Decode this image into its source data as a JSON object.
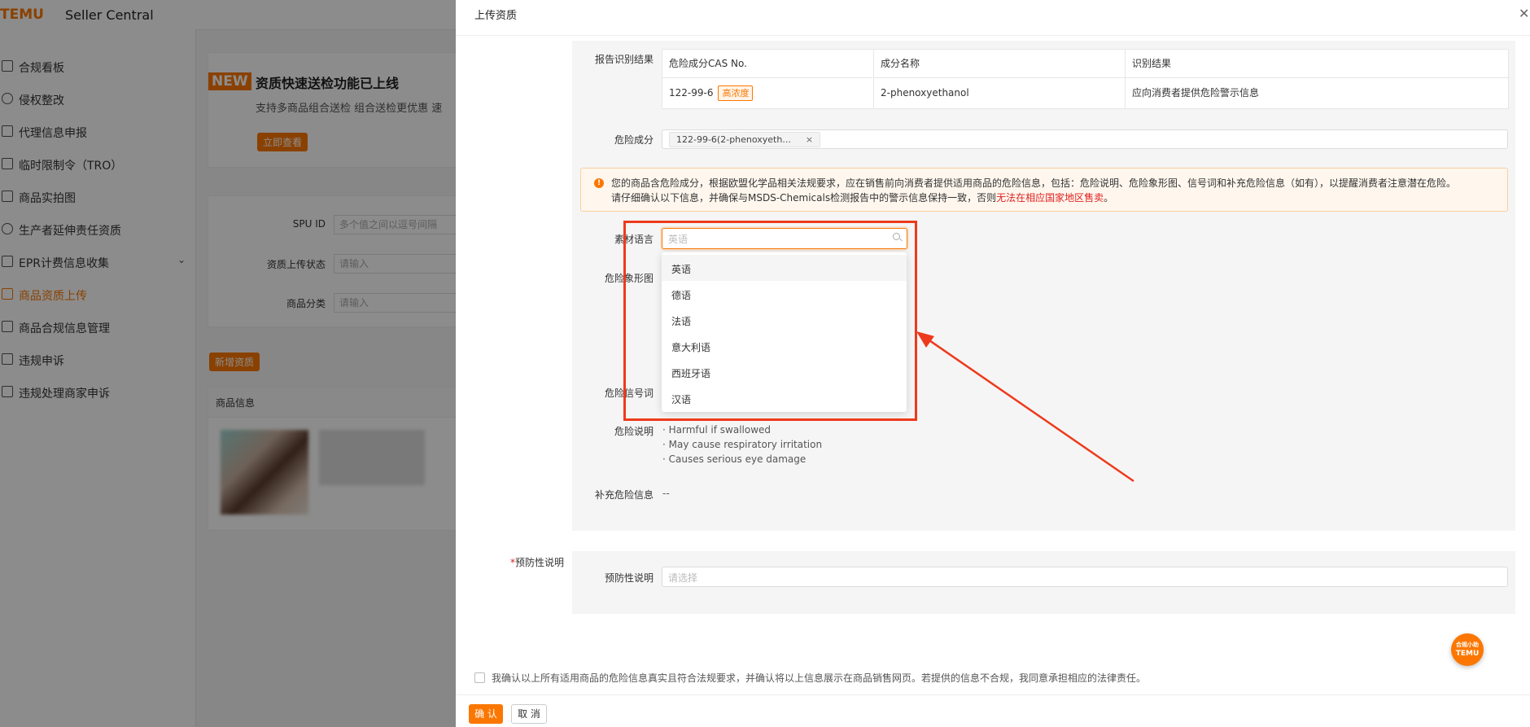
{
  "app": {
    "logo": "TEMU",
    "name": "Seller Central"
  },
  "sidebar": {
    "items": [
      {
        "label": "合规看板",
        "active": false
      },
      {
        "label": "侵权整改",
        "active": false
      },
      {
        "label": "代理信息申报",
        "active": false
      },
      {
        "label": "临时限制令（TRO）",
        "active": false
      },
      {
        "label": "商品实拍图",
        "active": false
      },
      {
        "label": "生产者延伸责任资质",
        "active": false
      },
      {
        "label": "EPR计费信息收集",
        "active": false
      },
      {
        "label": "商品资质上传",
        "active": true
      },
      {
        "label": "商品合规信息管理",
        "active": false
      },
      {
        "label": "违规申诉",
        "active": false
      },
      {
        "label": "违规处理商家申诉",
        "active": false
      }
    ]
  },
  "background": {
    "promo": {
      "badge": "NEW",
      "title": "资质快速送检功能已上线",
      "subtitle": "支持多商品组合送检 组合送检更优惠 速",
      "button": "立即查看"
    },
    "filters": [
      {
        "label": "SPU ID",
        "placeholder": "多个值之间以逗号间隔"
      },
      {
        "label": "资质上传状态",
        "placeholder": "请输入"
      },
      {
        "label": "商品分类",
        "placeholder": "请输入"
      }
    ],
    "add_button": "新增资质",
    "table_header": "商品信息"
  },
  "drawer": {
    "title": "上传资质",
    "report": {
      "label": "报告识别结果",
      "columns": [
        "危险成分CAS No.",
        "成分名称",
        "识别结果"
      ],
      "row": {
        "cas": "122-99-6",
        "tag": "高浓度",
        "name": "2-phenoxyethanol",
        "result": "应向消费者提供危险警示信息"
      }
    },
    "hazard_component": {
      "label": "危险成分",
      "chip": "122-99-6(2-phenoxyeth...",
      "chip_close": "×"
    },
    "warning": {
      "line1": "您的商品含危险成分，根据欧盟化学品相关法规要求，应在销售前向消费者提供适用商品的危险信息，包括：危险说明、危险象形图、信号词和补充危险信息（如有），以提醒消费者注意潜在危险。",
      "line2_prefix": "请仔细确认以下信息，并确保与MSDS-Chemicals检测报告中的警示信息保持一致，否则",
      "line2_red": "无法在相应国家地区售卖",
      "line2_suffix": "。"
    },
    "material_language": {
      "label": "素材语言",
      "placeholder": "英语",
      "options": [
        "英语",
        "德语",
        "法语",
        "意大利语",
        "西班牙语",
        "汉语"
      ]
    },
    "hazard_pictogram": {
      "label": "危险象形图"
    },
    "signal_word": {
      "label": "危险信号词"
    },
    "hazard_statement": {
      "label": "危险说明",
      "lines": [
        "· Harmful if swallowed",
        "· May cause respiratory irritation",
        "· Causes serious eye damage"
      ]
    },
    "supplement": {
      "label": "补充危险信息",
      "value": "--"
    },
    "precaution": {
      "section_label": "预防性说明",
      "required_mark": "*",
      "field_label": "预防性说明",
      "placeholder": "请选择"
    },
    "confirm_text": "我确认以上所有适用商品的危险信息真实且符合法规要求，并确认将以上信息展示在商品销售网页。若提供的信息不合规，我同意承担相应的法律责任。",
    "buttons": {
      "ok": "确 认",
      "cancel": "取 消"
    },
    "float_btn": {
      "line1": "合规小助",
      "line2": "TEMU"
    }
  },
  "colors": {
    "accent": "#fb7701",
    "annotation": "#ee3a1c",
    "warning_red": "#e02020"
  }
}
